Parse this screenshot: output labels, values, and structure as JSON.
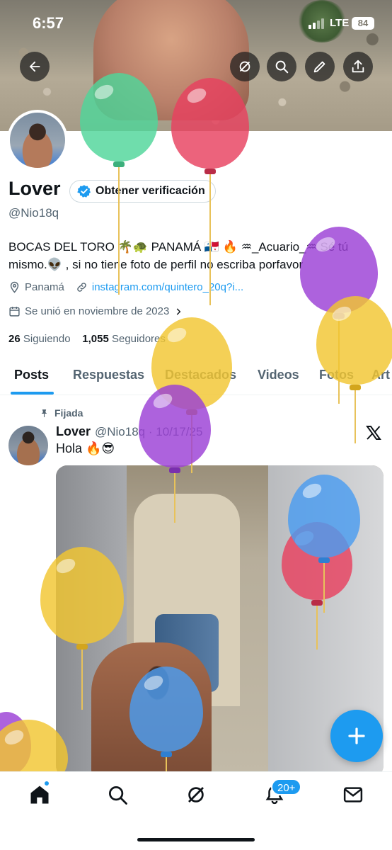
{
  "status_bar": {
    "time": "6:57",
    "network": "LTE",
    "battery": "84"
  },
  "header": {
    "back_label": "back",
    "icons": [
      "back-arrow-icon",
      "grok-icon",
      "search-icon",
      "edit-pencil-icon",
      "share-icon"
    ]
  },
  "profile": {
    "name": "Lover",
    "verify_button": "Obtener verificación",
    "handle": "@Nio18q",
    "bio": "BOCAS DEL TORO 🌴🐢 PANAMÁ 🇵🇦 🔥 ♒_Acuario_♒ Sé tú mismo.👽 , si no tiene foto de perfil no escriba porfavor",
    "location": "Panamá",
    "website": "instagram.com/quintero_20q?i...",
    "joined": "Se unió en noviembre de 2023",
    "following_count": "26",
    "following_label": "Siguiendo",
    "followers_count": "1,055",
    "followers_label": "Seguidores"
  },
  "tabs": [
    "Posts",
    "Respuestas",
    "Destacados",
    "Videos",
    "Fotos",
    "Art"
  ],
  "active_tab": "Posts",
  "pinned_post": {
    "pinned_label": "Fijada",
    "author": "Lover",
    "handle_date": "@Nio18q · 10/17/25",
    "text": "Hola 🔥😎"
  },
  "bottom_nav": {
    "items": [
      "home-icon",
      "search-icon",
      "grok-icon",
      "notifications-icon",
      "messages-icon"
    ],
    "notifications_badge": "20+"
  },
  "colors": {
    "accent": "#1d9bf0",
    "text_primary": "#0f1419",
    "text_secondary": "#536471",
    "balloon_green": "#4fd69a",
    "balloon_red": "#e8415f",
    "balloon_purple": "#9b3fd6",
    "balloon_yellow": "#f2c631",
    "balloon_blue": "#4a9cf0"
  }
}
